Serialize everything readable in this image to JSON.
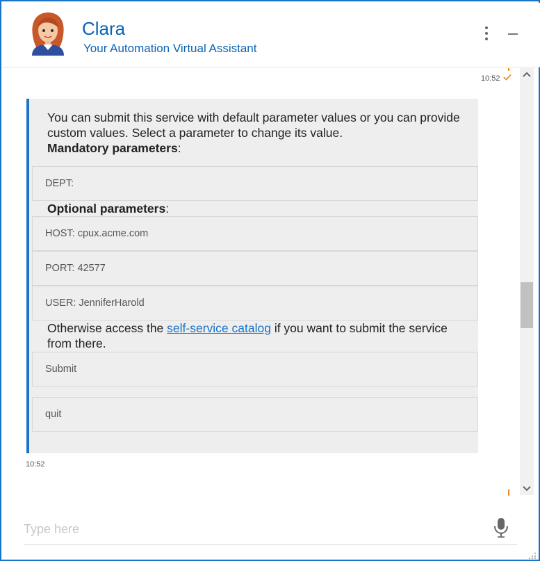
{
  "header": {
    "name": "Clara",
    "subtitle": "Your Automation Virtual Assistant"
  },
  "chat": {
    "top_time": "10:52",
    "message": {
      "intro": "You can submit this service with default parameter values or you can provide custom values. Select a parameter to change its value.",
      "mandatory_label": "Mandatory parameters",
      "mandatory": [
        "DEPT:"
      ],
      "optional_label": "Optional parameters",
      "optional": [
        "HOST: cpux.acme.com",
        "PORT: 42577",
        "USER: JenniferHarold"
      ],
      "otherwise_pre": "Otherwise access the ",
      "link_text": "self-service catalog",
      "otherwise_post": " if you want to submit the service from there.",
      "actions": [
        "Submit",
        "quit"
      ],
      "colon": ":"
    },
    "bottom_time": "10:52"
  },
  "input": {
    "placeholder": "Type here"
  },
  "colors": {
    "accent": "#1a73c7",
    "brand_text": "#0a64b4",
    "bubble_bg": "#eeeeee",
    "orange": "#f08a24"
  }
}
